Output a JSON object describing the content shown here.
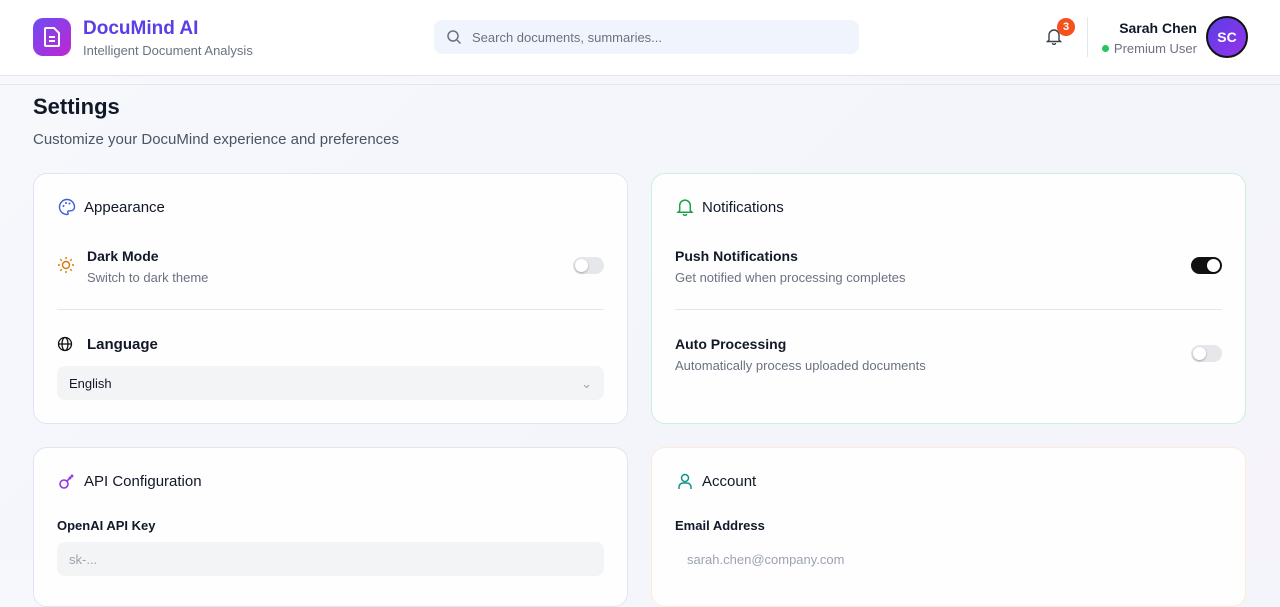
{
  "header": {
    "brand": "DocuMind AI",
    "tagline": "Intelligent Document Analysis",
    "search_placeholder": "Search documents, summaries...",
    "notification_count": "3",
    "user_name": "Sarah Chen",
    "user_role": "Premium User",
    "avatar_initials": "SC"
  },
  "page": {
    "title": "Settings",
    "subtitle": "Customize your DocuMind experience and preferences"
  },
  "appearance": {
    "title": "Appearance",
    "dark_mode_label": "Dark Mode",
    "dark_mode_desc": "Switch to dark theme",
    "dark_mode_on": false,
    "language_label": "Language",
    "language_value": "English"
  },
  "notifications": {
    "title": "Notifications",
    "push_label": "Push Notifications",
    "push_desc": "Get notified when processing completes",
    "push_on": true,
    "auto_label": "Auto Processing",
    "auto_desc": "Automatically process uploaded documents",
    "auto_on": false
  },
  "api": {
    "title": "API Configuration",
    "key_label": "OpenAI API Key",
    "key_value": "sk-..."
  },
  "account": {
    "title": "Account",
    "email_label": "Email Address",
    "email_value": "sarah.chen@company.com"
  }
}
